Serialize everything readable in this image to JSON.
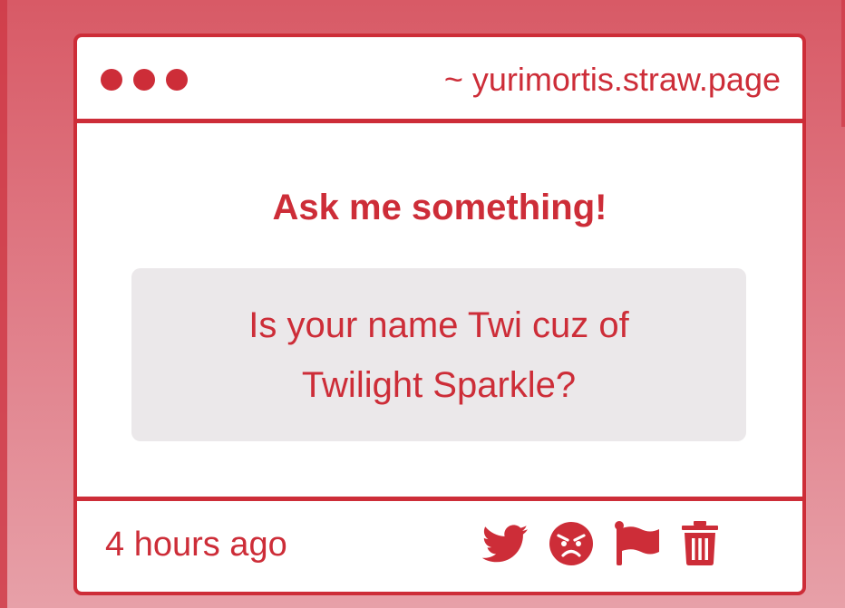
{
  "window": {
    "url": "~ yurimortis.straw.page"
  },
  "ask": {
    "heading": "Ask me something!",
    "question_line1": "Is your name Twi cuz of",
    "question_line2": "Twilight Sparkle?"
  },
  "footer": {
    "timestamp": "4 hours ago",
    "actions": [
      "twitter-icon",
      "angry-face-icon",
      "flag-icon",
      "trash-icon"
    ]
  },
  "colors": {
    "accent": "#cd2d38",
    "question_bg": "#ebe8ea",
    "card_bg": "#ffffff"
  }
}
